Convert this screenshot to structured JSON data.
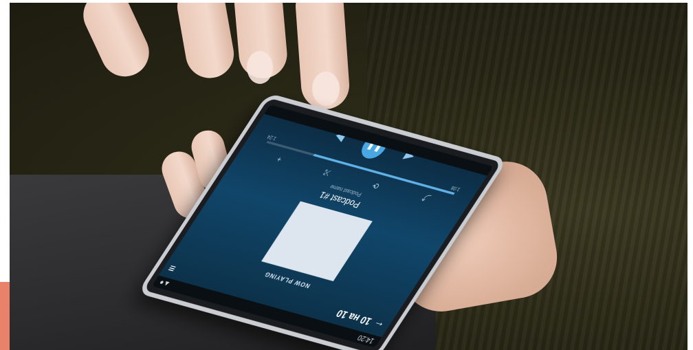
{
  "phone": {
    "status_time": "14:20",
    "date_header": "10 на 10",
    "now_playing_label": "NOW PLAYING",
    "track_title": "Podcast #1",
    "track_subtitle": "Podcast name",
    "progress_fraction": 0.75,
    "time_elapsed": "1:08",
    "time_total": "1:24",
    "icons": [
      "menu-icon",
      "back-icon",
      "search-icon",
      "share-icon",
      "shuffle-icon",
      "repeat-icon",
      "add-icon",
      "previous-icon",
      "pause-icon",
      "next-icon"
    ]
  },
  "colors": {
    "accent_bar": "#e8826a",
    "screen_blue": "#10466a",
    "play_button": "#49a8e3"
  }
}
